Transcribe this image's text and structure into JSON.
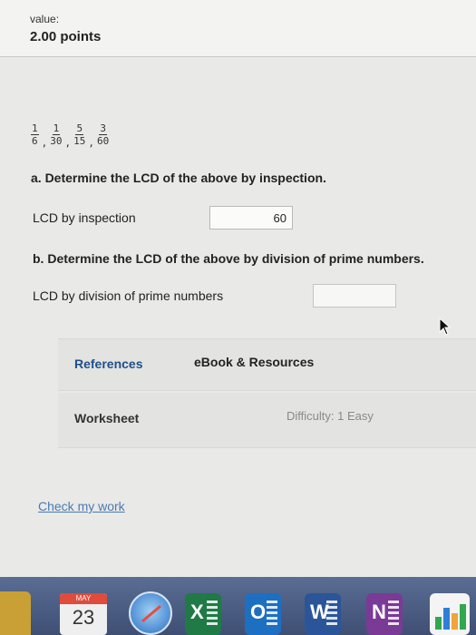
{
  "header": {
    "value_label": "value:",
    "points": "2.00 points"
  },
  "fractions": [
    {
      "num": "1",
      "den": "6"
    },
    {
      "num": "1",
      "den": "30"
    },
    {
      "num": "5",
      "den": "15"
    },
    {
      "num": "3",
      "den": "60"
    }
  ],
  "part_a": {
    "question": "a. Determine the LCD of the above by inspection.",
    "label": "LCD by inspection",
    "value": "60"
  },
  "part_b": {
    "question": "b. Determine the LCD of the above by division of prime numbers.",
    "label": "LCD by division of prime numbers",
    "value": ""
  },
  "resources": {
    "references": "References",
    "ebook": "eBook & Resources"
  },
  "worksheet": {
    "label": "Worksheet",
    "difficulty": "Difficulty: 1 Easy"
  },
  "check_label": "Check my work",
  "dock": {
    "calendar": {
      "month": "MAY",
      "day": "23"
    },
    "excel": "X",
    "outlook": "O",
    "word": "W",
    "onenote": "N",
    "colors": {
      "excel": "#1f7a45",
      "outlook": "#1d6fc2",
      "word": "#2a5699",
      "onenote": "#7a3a96"
    }
  }
}
